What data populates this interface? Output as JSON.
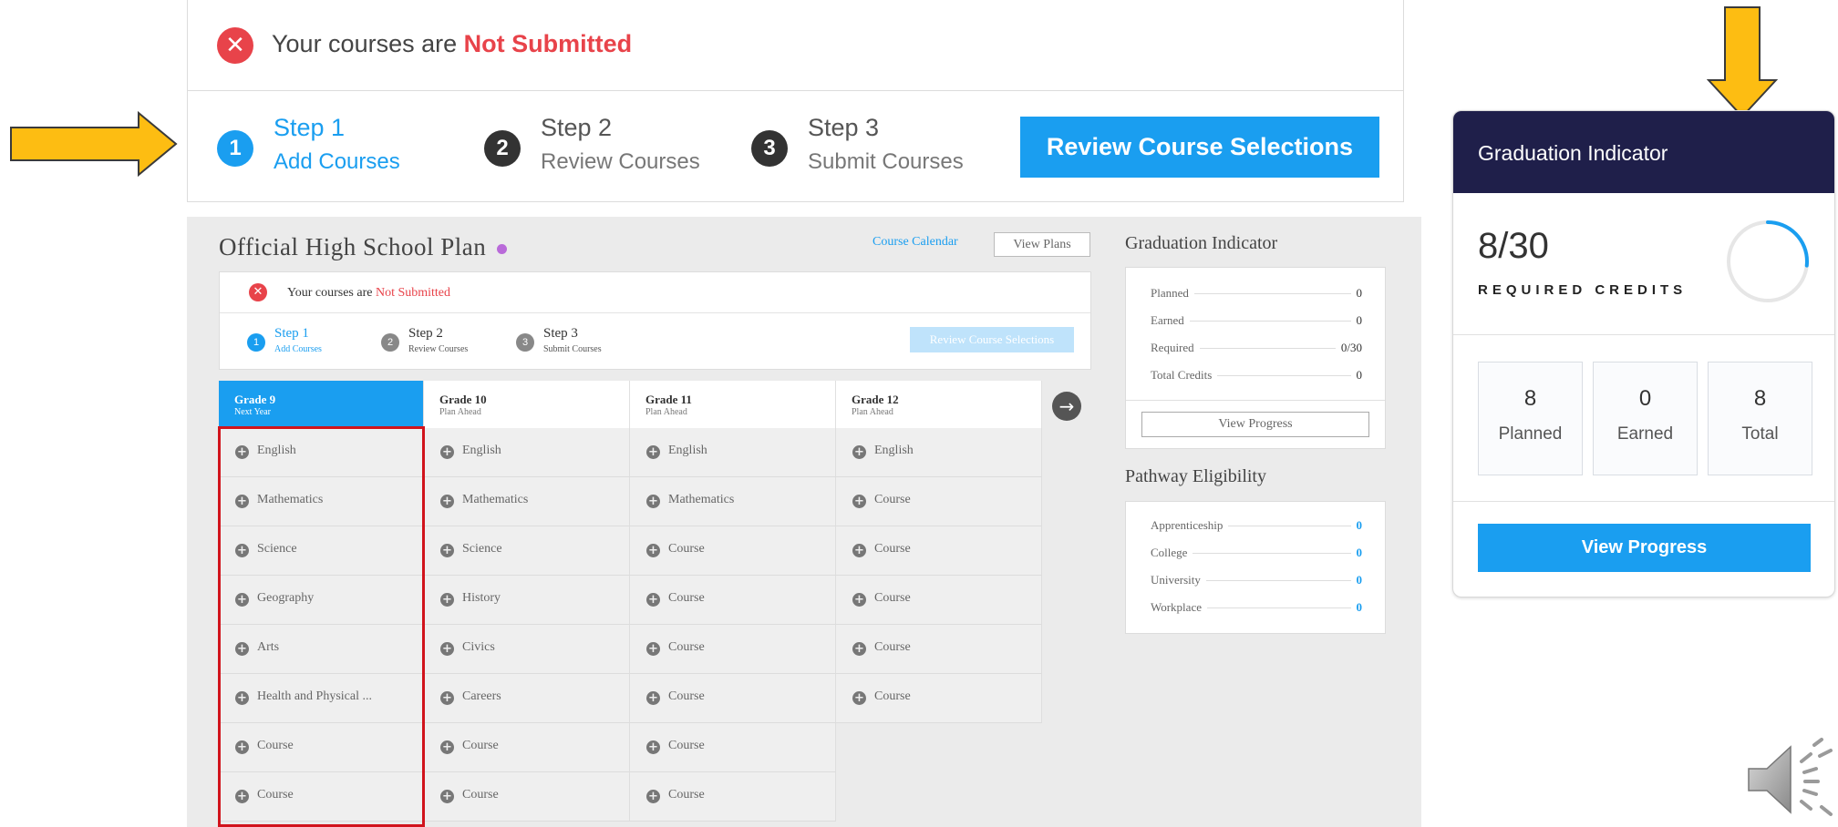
{
  "top_status": {
    "prefix": "Your courses are ",
    "state": "Not Submitted",
    "steps": [
      {
        "num": "1",
        "title": "Step 1",
        "sub": "Add Courses"
      },
      {
        "num": "2",
        "title": "Step 2",
        "sub": "Review Courses"
      },
      {
        "num": "3",
        "title": "Step 3",
        "sub": "Submit Courses"
      }
    ],
    "review_button": "Review Course Selections"
  },
  "plan": {
    "title": "Official High School Plan",
    "course_calendar_link": "Course Calendar",
    "view_plans_button": "View Plans",
    "status_prefix": "Your courses are ",
    "status_state": "Not Submitted",
    "steps": [
      {
        "num": "1",
        "title": "Step 1",
        "sub": "Add Courses"
      },
      {
        "num": "2",
        "title": "Step 2",
        "sub": "Review Courses"
      },
      {
        "num": "3",
        "title": "Step 3",
        "sub": "Submit Courses"
      }
    ],
    "review_button": "Review Course Selections",
    "next_arrow": "→",
    "grades": [
      {
        "name": "Grade 9",
        "sub": "Next Year",
        "active": true,
        "courses": [
          "English",
          "Mathematics",
          "Science",
          "Geography",
          "Arts",
          "Health and Physical ...",
          "Course",
          "Course"
        ]
      },
      {
        "name": "Grade 10",
        "sub": "Plan Ahead",
        "active": false,
        "courses": [
          "English",
          "Mathematics",
          "Science",
          "History",
          "Civics",
          "Careers",
          "Course",
          "Course"
        ]
      },
      {
        "name": "Grade 11",
        "sub": "Plan Ahead",
        "active": false,
        "courses": [
          "English",
          "Mathematics",
          "Course",
          "Course",
          "Course",
          "Course",
          "Course",
          "Course"
        ]
      },
      {
        "name": "Grade 12",
        "sub": "Plan Ahead",
        "active": false,
        "courses": [
          "English",
          "Course",
          "Course",
          "Course",
          "Course",
          "Course"
        ]
      }
    ]
  },
  "grad_indicator_small": {
    "title": "Graduation Indicator",
    "rows": [
      {
        "label": "Planned",
        "value": "0"
      },
      {
        "label": "Earned",
        "value": "0"
      },
      {
        "label": "Required",
        "value": "0/30"
      },
      {
        "label": "Total Credits",
        "value": "0"
      }
    ],
    "button": "View Progress"
  },
  "pathway": {
    "title": "Pathway Eligibility",
    "rows": [
      {
        "label": "Apprenticeship",
        "value": "0"
      },
      {
        "label": "College",
        "value": "0"
      },
      {
        "label": "University",
        "value": "0"
      },
      {
        "label": "Workplace",
        "value": "0"
      }
    ]
  },
  "grad_card": {
    "title": "Graduation Indicator",
    "credits": "8/30",
    "credits_label": "REQUIRED CREDITS",
    "progress_fraction": 0.267,
    "boxes": [
      {
        "value": "8",
        "label": "Planned"
      },
      {
        "value": "0",
        "label": "Earned"
      },
      {
        "value": "8",
        "label": "Total"
      }
    ],
    "button": "View Progress"
  },
  "colors": {
    "accent": "#1a9ef0",
    "danger": "#e8434a",
    "arrow": "#fdbd12",
    "card_header": "#1f1f4a",
    "highlight": "#d1131c"
  },
  "icons": [
    "close-icon",
    "plus-circle-icon",
    "arrow-right-icon",
    "speaker-icon",
    "annotation-arrow-icon"
  ]
}
